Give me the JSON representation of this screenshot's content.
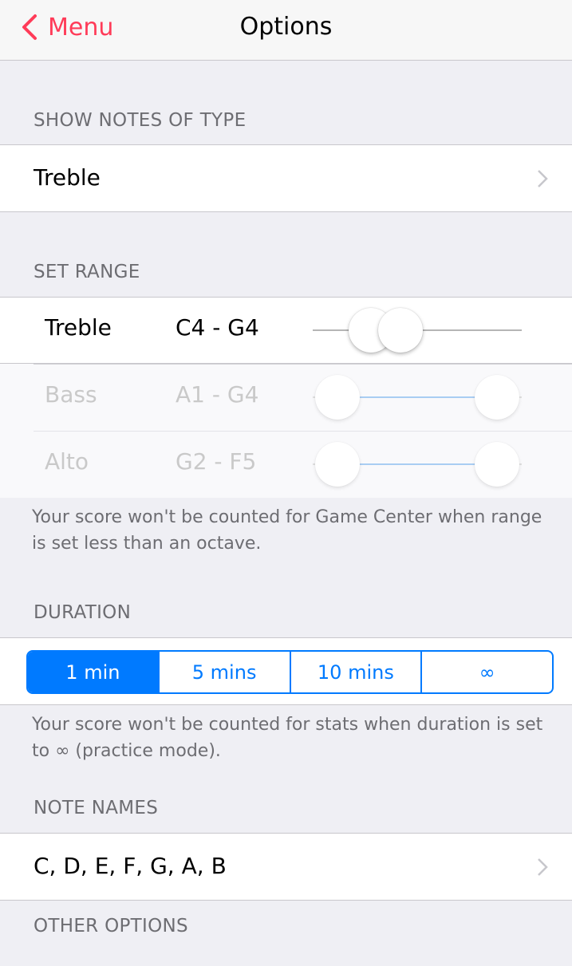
{
  "nav": {
    "back_label": "Menu",
    "title": "Options"
  },
  "sections": {
    "note_type": {
      "header": "SHOW NOTES OF TYPE",
      "value": "Treble"
    },
    "range": {
      "header": "SET RANGE",
      "rows": [
        {
          "name": "Treble",
          "range": "C4 - G4",
          "enabled": true,
          "low_fraction": 0.28,
          "high_fraction": 0.42
        },
        {
          "name": "Bass",
          "range": "A1 - G4",
          "enabled": false,
          "low_fraction": 0.12,
          "high_fraction": 0.88
        },
        {
          "name": "Alto",
          "range": "G2 - F5",
          "enabled": false,
          "low_fraction": 0.12,
          "high_fraction": 0.88
        }
      ],
      "footer": "Your score won't be counted for Game Center when range is set less than an octave."
    },
    "duration": {
      "header": "DURATION",
      "segments": [
        "1 min",
        "5 mins",
        "10 mins",
        "∞"
      ],
      "selected": "1 min",
      "footer": "Your score won't be counted for stats when duration is set to ∞ (practice mode)."
    },
    "note_names": {
      "header": "NOTE NAMES",
      "value": "C, D, E, F, G, A, B"
    },
    "other": {
      "header": "OTHER OPTIONS"
    }
  },
  "colors": {
    "accent": "#007aff",
    "back_tint": "#ff3b58",
    "background": "#efeff4"
  }
}
